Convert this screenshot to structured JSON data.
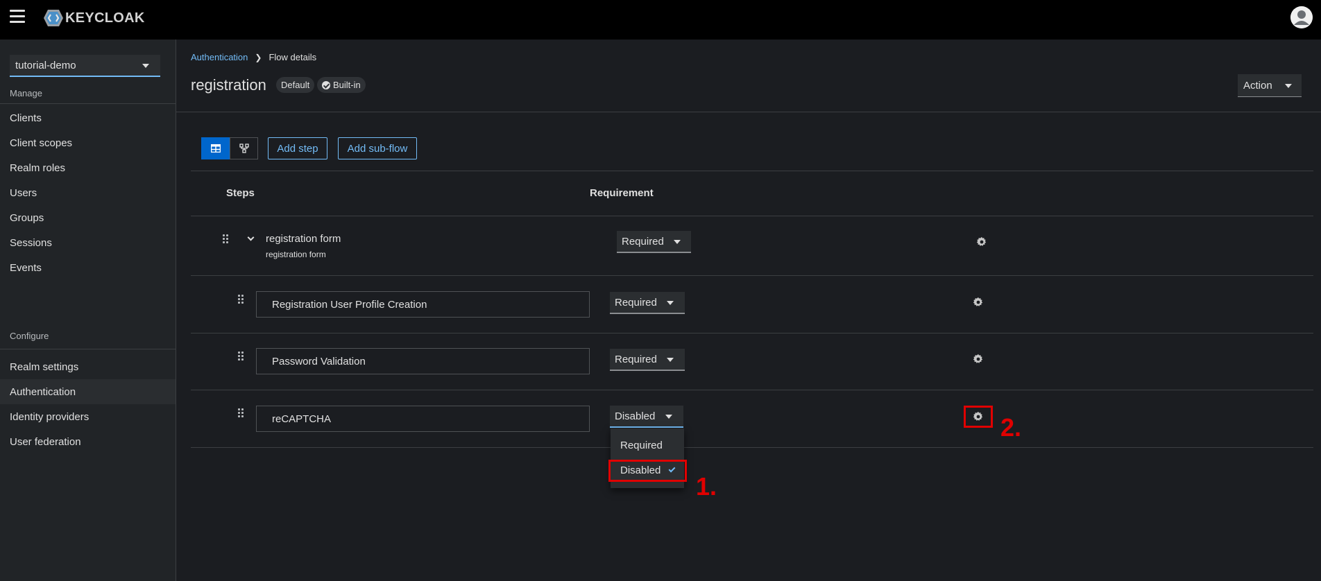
{
  "masthead": {
    "brand": "KEYCLOAK"
  },
  "sidebar": {
    "realm": "tutorial-demo",
    "manage_title": "Manage",
    "manage_items": [
      {
        "label": "Clients"
      },
      {
        "label": "Client scopes"
      },
      {
        "label": "Realm roles"
      },
      {
        "label": "Users"
      },
      {
        "label": "Groups"
      },
      {
        "label": "Sessions"
      },
      {
        "label": "Events"
      }
    ],
    "configure_title": "Configure",
    "configure_items": [
      {
        "label": "Realm settings"
      },
      {
        "label": "Authentication",
        "active": true
      },
      {
        "label": "Identity providers"
      },
      {
        "label": "User federation"
      }
    ]
  },
  "breadcrumb": {
    "parent": "Authentication",
    "current": "Flow details"
  },
  "header": {
    "title": "registration",
    "badge_default": "Default",
    "badge_builtin": "Built-in",
    "action_label": "Action"
  },
  "toolbar": {
    "add_step": "Add step",
    "add_subflow": "Add sub-flow"
  },
  "table": {
    "headers": {
      "steps": "Steps",
      "requirement": "Requirement"
    },
    "rows": [
      {
        "name": "registration form",
        "subtitle": "registration form",
        "requirement": "Required"
      },
      {
        "name": "Registration User Profile Creation",
        "requirement": "Required"
      },
      {
        "name": "Password Validation",
        "requirement": "Required"
      },
      {
        "name": "reCAPTCHA",
        "requirement": "Disabled"
      }
    ]
  },
  "dropdown": {
    "options": [
      {
        "label": "Required",
        "selected": false
      },
      {
        "label": "Disabled",
        "selected": true
      }
    ]
  },
  "annotations": {
    "one": "1.",
    "two": "2."
  },
  "colors": {
    "accent": "#73bcf7",
    "primary": "#0066cc",
    "annotation": "#e00000",
    "background": "#1b1d21",
    "sidebar": "#212427"
  }
}
